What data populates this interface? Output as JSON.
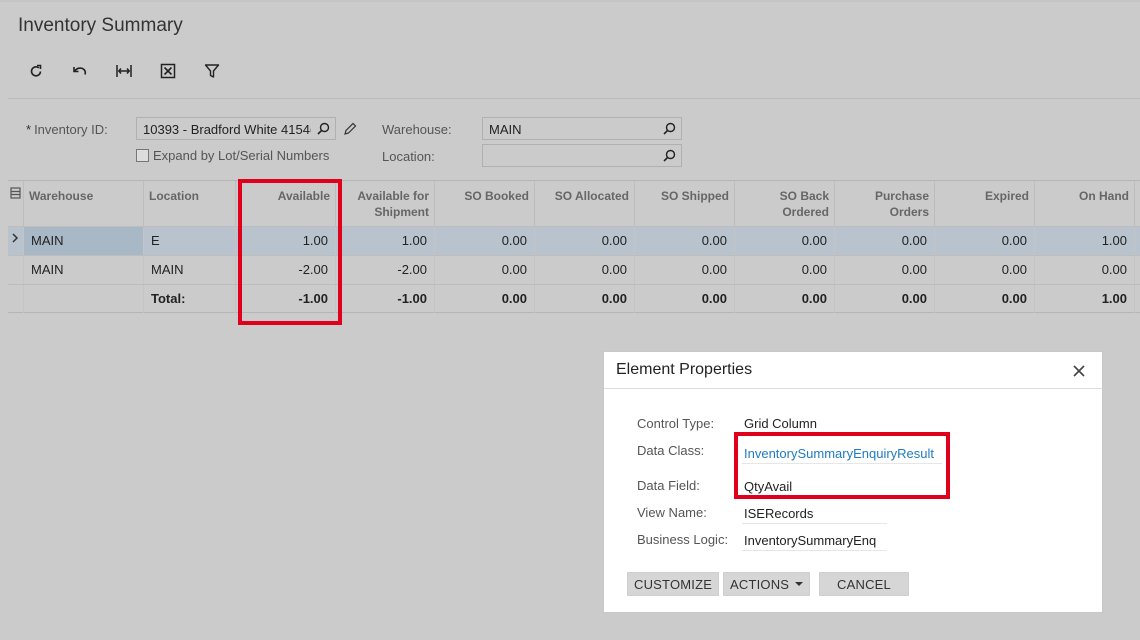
{
  "page_title": "Inventory Summary",
  "toolbar": {
    "icons": [
      "refresh-icon",
      "undo-icon",
      "fit-columns-icon",
      "export-excel-icon",
      "filter-icon"
    ]
  },
  "form": {
    "inventory_id_label": "Inventory ID:",
    "inventory_id_required": "*",
    "inventory_id_value": "10393 - Bradford White 4154(",
    "expand_label": "Expand by Lot/Serial Numbers",
    "warehouse_label": "Warehouse:",
    "warehouse_value": "MAIN",
    "location_label": "Location:",
    "location_value": ""
  },
  "grid": {
    "columns": [
      "Warehouse",
      "Location",
      "Available",
      "Available for Shipment",
      "SO Booked",
      "SO Allocated",
      "SO Shipped",
      "SO Back Ordered",
      "Purchase Orders",
      "Expired",
      "On Hand"
    ],
    "rows": [
      {
        "warehouse": "MAIN",
        "location": "E",
        "available": "1.00",
        "available_for_shipment": "1.00",
        "so_booked": "0.00",
        "so_allocated": "0.00",
        "so_shipped": "0.00",
        "so_back_ordered": "0.00",
        "purchase_orders": "0.00",
        "expired": "0.00",
        "on_hand": "1.00"
      },
      {
        "warehouse": "MAIN",
        "location": "MAIN",
        "available": "-2.00",
        "available_for_shipment": "-2.00",
        "so_booked": "0.00",
        "so_allocated": "0.00",
        "so_shipped": "0.00",
        "so_back_ordered": "0.00",
        "purchase_orders": "0.00",
        "expired": "0.00",
        "on_hand": "0.00"
      }
    ],
    "total": {
      "label": "Total:",
      "available": "-1.00",
      "available_for_shipment": "-1.00",
      "so_booked": "0.00",
      "so_allocated": "0.00",
      "so_shipped": "0.00",
      "so_back_ordered": "0.00",
      "purchase_orders": "0.00",
      "expired": "0.00",
      "on_hand": "1.00"
    }
  },
  "dialog": {
    "title": "Element Properties",
    "control_type_label": "Control Type:",
    "control_type_value": "Grid Column",
    "data_class_label": "Data Class:",
    "data_class_value": "InventorySummaryEnquiryResult",
    "data_field_label": "Data Field:",
    "data_field_value": "QtyAvail",
    "view_name_label": "View Name:",
    "view_name_value": "ISERecords",
    "business_logic_label": "Business Logic:",
    "business_logic_value": "InventorySummaryEnq",
    "customize_label": "CUSTOMIZE",
    "actions_label": "ACTIONS",
    "cancel_label": "CANCEL"
  },
  "colors": {
    "highlight": "#e0001b",
    "link": "#1f7cbf",
    "selected_row": "#b8c3cd"
  }
}
